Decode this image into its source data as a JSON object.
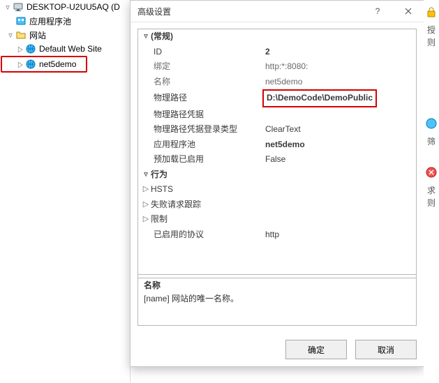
{
  "tree": {
    "root": "DESKTOP-U2UU5AQ (D",
    "appPools": "应用程序池",
    "sites": "网站",
    "defaultSite": "Default Web Site",
    "net5demo": "net5demo"
  },
  "dialog": {
    "title": "高级设置",
    "categories": {
      "general": "(常规)",
      "behavior": "行为"
    },
    "rows": {
      "id": {
        "label": "ID",
        "value": "2"
      },
      "binding": {
        "label": "绑定",
        "value": "http:*:8080:"
      },
      "name": {
        "label": "名称",
        "value": "net5demo"
      },
      "physicalPath": {
        "label": "物理路径",
        "value": "D:\\DemoCode\\DemoPublic"
      },
      "physCred": {
        "label": "物理路径凭据",
        "value": ""
      },
      "physCredLogon": {
        "label": "物理路径凭据登录类型",
        "value": "ClearText"
      },
      "appPool": {
        "label": "应用程序池",
        "value": "net5demo"
      },
      "preload": {
        "label": "预加载已启用",
        "value": "False"
      },
      "hsts": {
        "label": "HSTS",
        "value": ""
      },
      "frt": {
        "label": "失败请求跟踪",
        "value": ""
      },
      "limits": {
        "label": "限制",
        "value": ""
      },
      "proto": {
        "label": "已启用的协议",
        "value": "http"
      }
    },
    "desc": {
      "name": "名称",
      "text": "[name] 网站的唯一名称。"
    },
    "ok": "确定",
    "cancel": "取消"
  },
  "right": {
    "t1": "授",
    "t2": "则",
    "t3": "筛",
    "t4": "求",
    "t5": "则"
  }
}
